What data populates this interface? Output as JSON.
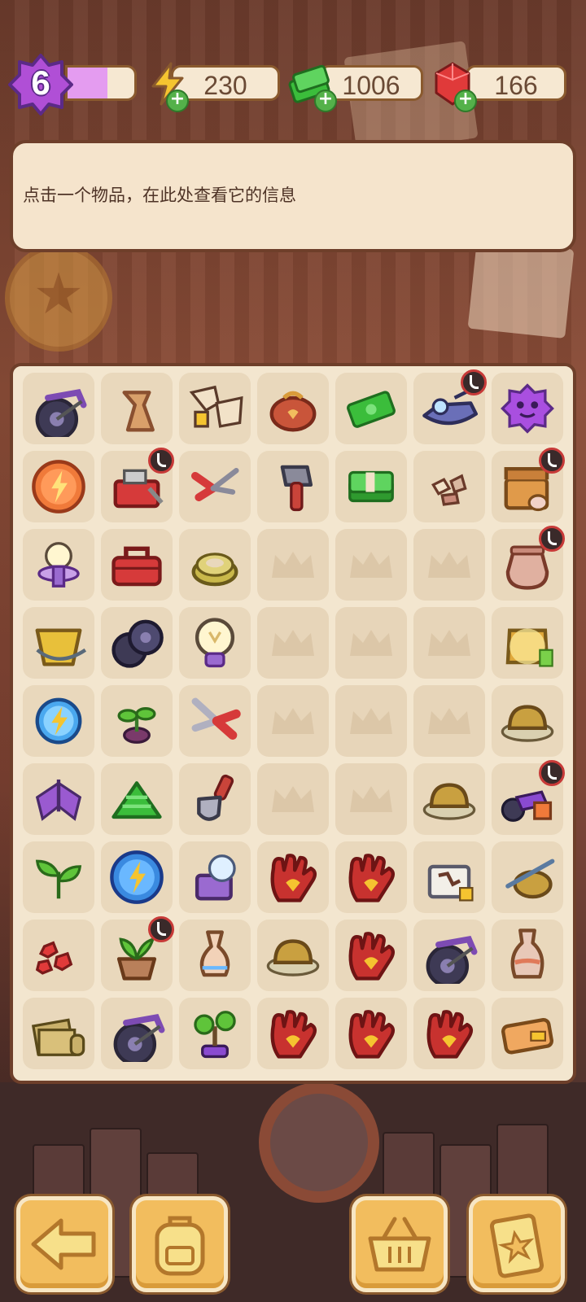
{
  "hud": {
    "level": "6",
    "xp_progress": 0.6,
    "energy": "230",
    "cash": "1006",
    "gems": "166",
    "colors": {
      "xp": "#e49cf0",
      "energy": "#f5c430",
      "cash": "#3bbd3b",
      "gem": "#e03a3a"
    }
  },
  "info": {
    "text": "点击一个物品，在此处查看它的信息"
  },
  "board": {
    "rows": [
      [
        "bike",
        "horseshoe",
        "map-pieces",
        "coin-pouch",
        "cash-bill",
        "jet-ski",
        "purple-slime"
      ],
      [
        "energy-orb-orange",
        "toolbox-open",
        "pruning-shears",
        "axe",
        "cash-stack",
        "stone-chips",
        "treasure-chest"
      ],
      [
        "light-bulb",
        "toolbox",
        "rope-coil",
        "empty",
        "empty",
        "empty",
        "clay-pot"
      ],
      [
        "bucket",
        "wheels",
        "light-bulb-large",
        "empty",
        "empty",
        "empty",
        "magic-bag"
      ],
      [
        "energy-orb-blue-small",
        "sprout",
        "scissors",
        "empty",
        "empty",
        "empty",
        "hat-nest"
      ],
      [
        "moth",
        "cash-pile",
        "shovel",
        "empty",
        "empty",
        "hat-nest",
        "motorbike"
      ],
      [
        "leaf-plant",
        "energy-orb-blue",
        "lamp-box",
        "glove",
        "glove",
        "map-box",
        "fishing-rod"
      ],
      [
        "ruby-cluster",
        "potted-plant",
        "vase",
        "hat-nest",
        "glove",
        "bike",
        "vase-tall"
      ],
      [
        "map-stack",
        "bike",
        "bonsai",
        "glove",
        "glove",
        "glove",
        "wallet"
      ]
    ],
    "timer_badges": [
      "jet-ski",
      "toolbox-open",
      "treasure-chest",
      "clay-pot",
      "motorbike",
      "potted-plant"
    ]
  },
  "buttons": {
    "back": "arrow-left-icon",
    "inventory": "backpack-icon",
    "shop": "basket-icon",
    "orders": "clipboard-icon"
  }
}
